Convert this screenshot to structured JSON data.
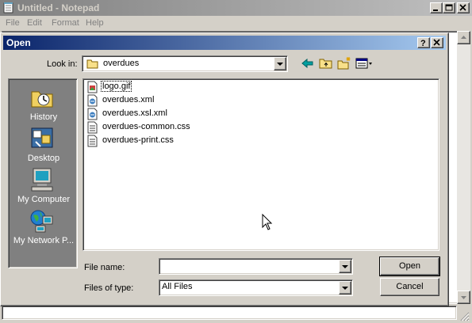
{
  "notepad": {
    "title": "Untitled - Notepad",
    "menu": [
      "File",
      "Edit",
      "Format",
      "Help"
    ]
  },
  "dialog": {
    "title": "Open",
    "look_in_label": "Look in:",
    "look_in_value": "overdues",
    "toolbar_icons": [
      "back-icon",
      "up-folder-icon",
      "new-folder-icon",
      "view-menu-icon"
    ],
    "places": [
      {
        "label": "History",
        "icon": "history-icon"
      },
      {
        "label": "Desktop",
        "icon": "desktop-icon"
      },
      {
        "label": "My Computer",
        "icon": "my-computer-icon"
      },
      {
        "label": "My Network P...",
        "icon": "network-places-icon"
      }
    ],
    "files": [
      {
        "name": "logo.gif",
        "icon": "gif-file-icon"
      },
      {
        "name": "overdues.xml",
        "icon": "xml-file-icon"
      },
      {
        "name": "overdues.xsl.xml",
        "icon": "xml-file-icon"
      },
      {
        "name": "overdues-common.css",
        "icon": "css-file-icon"
      },
      {
        "name": "overdues-print.css",
        "icon": "css-file-icon"
      }
    ],
    "file_name_label": "File name:",
    "file_name_value": "",
    "files_of_type_label": "Files of type:",
    "files_of_type_value": "All Files",
    "open_button": "Open",
    "cancel_button": "Cancel"
  }
}
